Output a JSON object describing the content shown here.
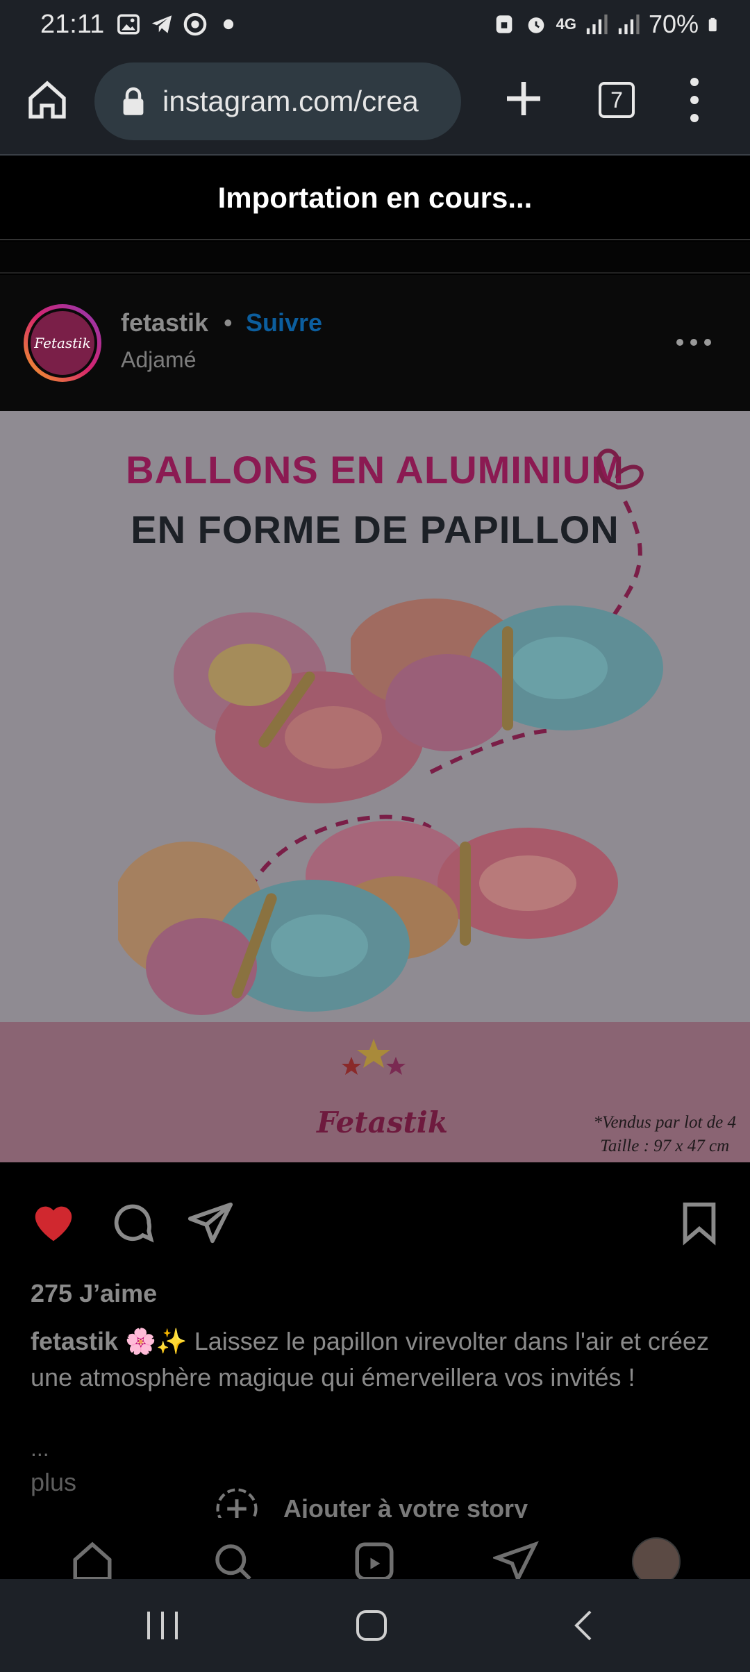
{
  "status_bar": {
    "time": "21:11",
    "battery": "70%",
    "network": "4G",
    "left_icons": [
      "image-icon",
      "telegram-icon",
      "chrome-icon",
      "dot-icon"
    ],
    "right_icons": [
      "lock-icon",
      "alarm-icon",
      "network-4g-icon",
      "signal-icon",
      "signal-icon",
      "battery-icon"
    ]
  },
  "browser": {
    "url": "instagram.com/crea",
    "tab_count": "7"
  },
  "banner": {
    "text": "Importation en cours..."
  },
  "post": {
    "username": "fetastik",
    "separator": "•",
    "follow_label": "Suivre",
    "location": "Adjamé",
    "avatar_text": "Fetastik",
    "image": {
      "headline_line1": "BALLONS EN ALUMINIUM",
      "headline_line2": "EN FORME DE PAPILLON",
      "brand": "Fetastik",
      "note_line1": "*Vendus par lot de 4",
      "note_line2": "Taille : 97 x 47 cm"
    },
    "likes": "275 J’aime",
    "caption_user": "fetastik",
    "caption_text": " 🌸✨ Laissez le papillon virevolter dans l'air et créez une atmosphère magique qui émerveillera vos invités !",
    "caption_ellipsis": "...",
    "more_label": "plus",
    "liked": true
  },
  "story": {
    "label": "Ajouter à votre story"
  },
  "colors": {
    "accent_blue": "#0c5e9e",
    "like_red": "#d0282f",
    "headline_pink": "#8b1a52"
  }
}
